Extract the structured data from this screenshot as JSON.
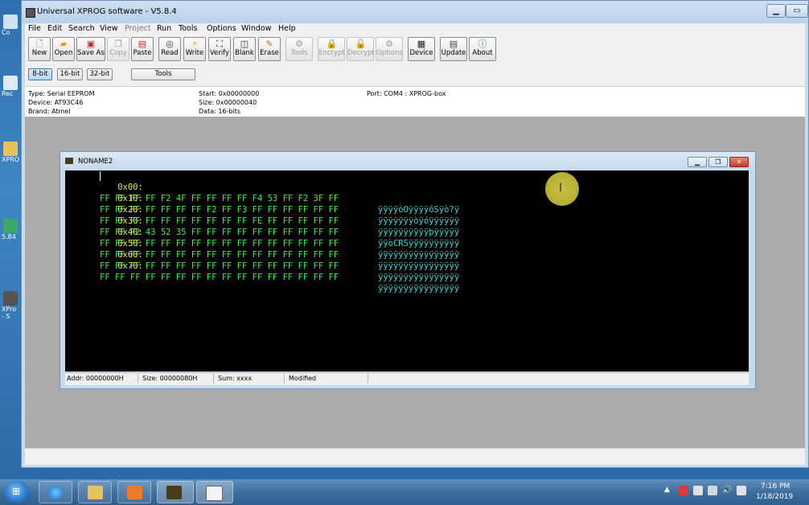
{
  "window": {
    "title": "Universal XPROG software - V5.8.4"
  },
  "menu": [
    {
      "label": "File",
      "enabled": true
    },
    {
      "label": "Edit",
      "enabled": true
    },
    {
      "label": "Search",
      "enabled": true
    },
    {
      "label": "View",
      "enabled": true
    },
    {
      "label": "Project",
      "enabled": false
    },
    {
      "label": "Run",
      "enabled": true
    },
    {
      "label": "Tools",
      "enabled": true
    },
    {
      "label": "Options",
      "enabled": true
    },
    {
      "label": "Window",
      "enabled": true
    },
    {
      "label": "Help",
      "enabled": true
    }
  ],
  "toolbar": {
    "new": "New",
    "open": "Open",
    "save_as": "Save As",
    "copy": "Copy",
    "paste": "Paste",
    "read": "Read",
    "write": "Write",
    "verify": "Verify",
    "blank": "Blank",
    "erase": "Erase",
    "tools": "Tools",
    "encrypt": "Encrypt",
    "decrypt": "Decrypt",
    "options": "Options",
    "device": "Device",
    "update": "Update",
    "about": "About"
  },
  "bitbar": {
    "b8": "8-bit",
    "b16": "16-bit",
    "b32": "32-bit",
    "tools": "Tools"
  },
  "info": {
    "type": "Type: Serial EEPROM",
    "device": "Device: AT93C46",
    "brand": "Brand: Atmel",
    "start": "Start: 0x00000000",
    "size": "Size: 0x00000040",
    "data": "Data: 16-bits",
    "port": "Port: COM4 : XPROG-box"
  },
  "child": {
    "title": "NONAME2",
    "rows": [
      {
        "addr": "0x00:",
        "bytes": "FF FF FF FF F2 4F FF FF FF FF F4 53 FF F2 3F FF",
        "ascii": "ÿÿÿÿòOÿÿÿÿôSÿò?ÿ"
      },
      {
        "addr": "0x10:",
        "bytes": "FF FF FF FF FF FF FF F2 FF F3 FF FF FF FF FF FF",
        "ascii": "ÿÿÿÿÿÿÿòÿóÿÿÿÿÿÿ"
      },
      {
        "addr": "0x20:",
        "bytes": "FF FF FF FF FF FF FF FF FF FF FE FF FF FF FF FF",
        "ascii": "ÿÿÿÿÿÿÿÿÿÿþÿÿÿÿÿ"
      },
      {
        "addr": "0x30:",
        "bytes": "FF FF F2 43 52 35 FF FF FF FF FF FF FF FF FF FF",
        "ascii": "ÿÿòCR5ÿÿÿÿÿÿÿÿÿÿ"
      },
      {
        "addr": "0x40:",
        "bytes": "FF FF FF FF FF FF FF FF FF FF FF FF FF FF FF FF",
        "ascii": "ÿÿÿÿÿÿÿÿÿÿÿÿÿÿÿÿ"
      },
      {
        "addr": "0x50:",
        "bytes": "FF FF FF FF FF FF FF FF FF FF FF FF FF FF FF FF",
        "ascii": "ÿÿÿÿÿÿÿÿÿÿÿÿÿÿÿÿ"
      },
      {
        "addr": "0x60:",
        "bytes": "FF FF FF FF FF FF FF FF FF FF FF FF FF FF FF FF",
        "ascii": "ÿÿÿÿÿÿÿÿÿÿÿÿÿÿÿÿ"
      },
      {
        "addr": "0x70:",
        "bytes": "FF FF FF FF FF FF FF FF FF FF FF FF FF FF FF FF",
        "ascii": "ÿÿÿÿÿÿÿÿÿÿÿÿÿÿÿÿ"
      }
    ],
    "status": {
      "addr": "Addr: 00000000H",
      "size": "Size: 00000080H",
      "sum": "Sum: xxxx",
      "state": "Modified"
    }
  },
  "desktop_icons": [
    {
      "label": "Co",
      "icon": "computer-icon"
    },
    {
      "label": "Rec",
      "icon": "recycle-bin-icon"
    },
    {
      "label": "XPRO",
      "icon": "folder-icon"
    },
    {
      "label": "5.84",
      "icon": "shortcut-icon"
    },
    {
      "label": "XPro - S",
      "icon": "xprog-icon"
    }
  ],
  "taskbar": {
    "time": "7:16 PM",
    "date": "1/18/2019",
    "apps": [
      "internet-explorer-icon",
      "file-explorer-icon",
      "media-player-icon",
      "xprog-chip-icon",
      "window-app-icon"
    ]
  },
  "colors": {
    "hex_address": "#e8e25a",
    "hex_bytes": "#3cf040",
    "hex_ascii": "#36d4d8",
    "hex_background": "#000000"
  }
}
